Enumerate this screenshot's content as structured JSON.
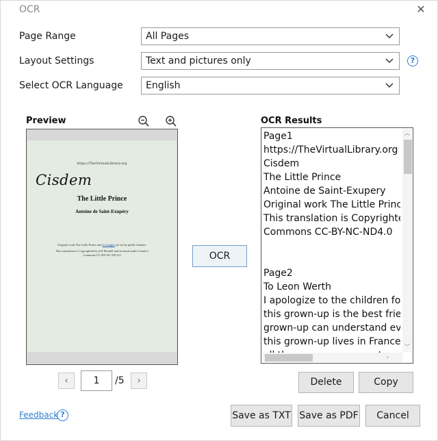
{
  "window": {
    "title": "OCR"
  },
  "form": {
    "page_range": {
      "label": "Page Range",
      "value": "All Pages"
    },
    "layout_settings": {
      "label": "Layout Settings",
      "value": "Text and pictures only"
    },
    "ocr_language": {
      "label": "Select OCR Language",
      "value": "English"
    }
  },
  "preview": {
    "label": "Preview",
    "page": {
      "url": "https://TheVirtualLibrary.org",
      "logo": "Cisdem",
      "title": "The Little Prince",
      "author": "Antoine de Saint-Exupéry",
      "note_line1_a": "Original work The Little Prince and ",
      "note_line1_link": "its images",
      "note_line1_b": " are in the public domain.",
      "note_line2": "This translation is Copyrighted by Jeff Mcneill and licensed under Creative",
      "note_line3": "Commons CC-BY-NC-ND 4.0"
    }
  },
  "ocr_button": "OCR",
  "results": {
    "label": "OCR Results",
    "lines": [
      "Page1",
      "https://TheVirtualLibrary.org",
      "Cisdem",
      "The Little Prince",
      "Antoine de Saint-Exupery",
      "Original work The Little Prince and its images are in the public domain.",
      "This translation is Copyrighted by Jeff Mcneill and licensed under Creative",
      "Commons CC-BY-NC-ND4.0",
      "",
      "",
      "Page2",
      "To Leon Werth",
      "I apologize to the children for dedicating this book to a grown-up.",
      "this grown-up is the best friend I have in the world.",
      "grown-up can understand everything, even books for children.",
      "this grown-up lives in France where he is hungry and cold.",
      "all these reasons are not enough"
    ]
  },
  "pager": {
    "current": "1",
    "total": "/5"
  },
  "actions": {
    "delete": "Delete",
    "copy": "Copy",
    "save_txt": "Save as TXT",
    "save_pdf": "Save as PDF",
    "cancel": "Cancel"
  },
  "footer": {
    "feedback": "Feedback"
  },
  "icons": {
    "close": "close-icon",
    "chevron": "chevron-down-icon",
    "help": "help-icon",
    "zoom_out": "zoom-out-icon",
    "zoom_in": "zoom-in-icon"
  },
  "colors": {
    "accent": "#2f7fd0",
    "page_bg": "#e3ebe2"
  }
}
